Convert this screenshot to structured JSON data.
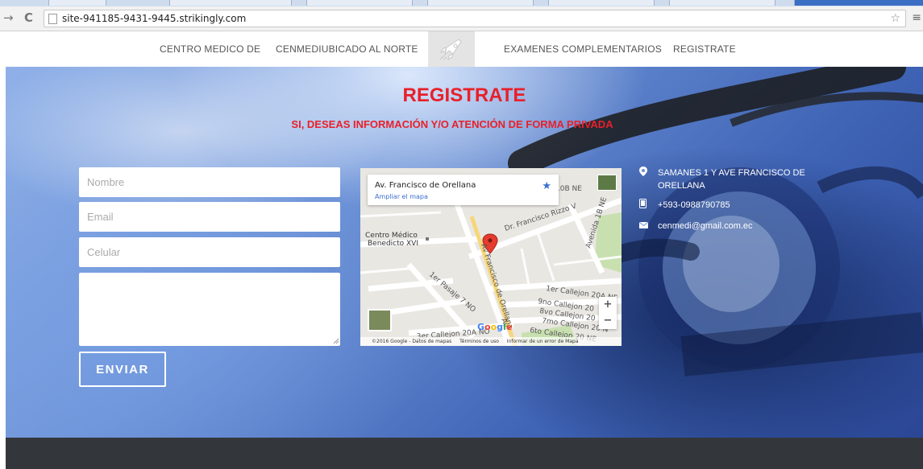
{
  "browser": {
    "url": "site-941185-9431-9445.strikingly.com"
  },
  "nav": {
    "items": [
      "CENTRO MEDICO DE",
      "CENMEDIUBICADO AL NORTE",
      "EXAMENES COMPLEMENTARIOS",
      "REGISTRATE"
    ]
  },
  "hero": {
    "title": "REGISTRATE",
    "subtitle": "SI, DESEAS INFORMACIÓN Y/O ATENCIÓN DE FORMA PRIVADA",
    "accent_color": "#e8202a"
  },
  "form": {
    "name_placeholder": "Nombre",
    "email_placeholder": "Email",
    "phone_placeholder": "Celular",
    "message_value": "",
    "submit_label": "ENVIAR"
  },
  "map": {
    "card_title": "Av. Francisco de Orellana",
    "card_link": "Ampliar el mapa",
    "labels": {
      "place": "Centro Médico\nBenedicto XVI",
      "street_main": "Av Francisco de Orellana",
      "street_rizzo": "Dr. Francisco Rizzo V",
      "avenida_1b": "Avenida 1B NE",
      "callejon_10b": "10B NE",
      "callejon_1": "1er Callejon 20A NE",
      "pasaje": "1er Pasaje 7 NO",
      "callejon_9": "9no Callejon 20",
      "callejon_8": "8vo Callejon 20",
      "callejon_7": "7mo Callejon 20 N",
      "callejon_6": "6to Callejon 20 NE",
      "callejon_3": "3er Callejon 20A NO",
      "av_short": "Av"
    },
    "footer": {
      "copyright": "©2016 Google - Datos de mapas",
      "terms": "Términos de uso",
      "report": "Informar de un error de Mapa"
    }
  },
  "contact": {
    "address": "SAMANES 1 Y AVE FRANCISCO DE ORELLANA",
    "phone": "+593-0988790785",
    "email": "cenmedi@gmail.com.ec"
  }
}
